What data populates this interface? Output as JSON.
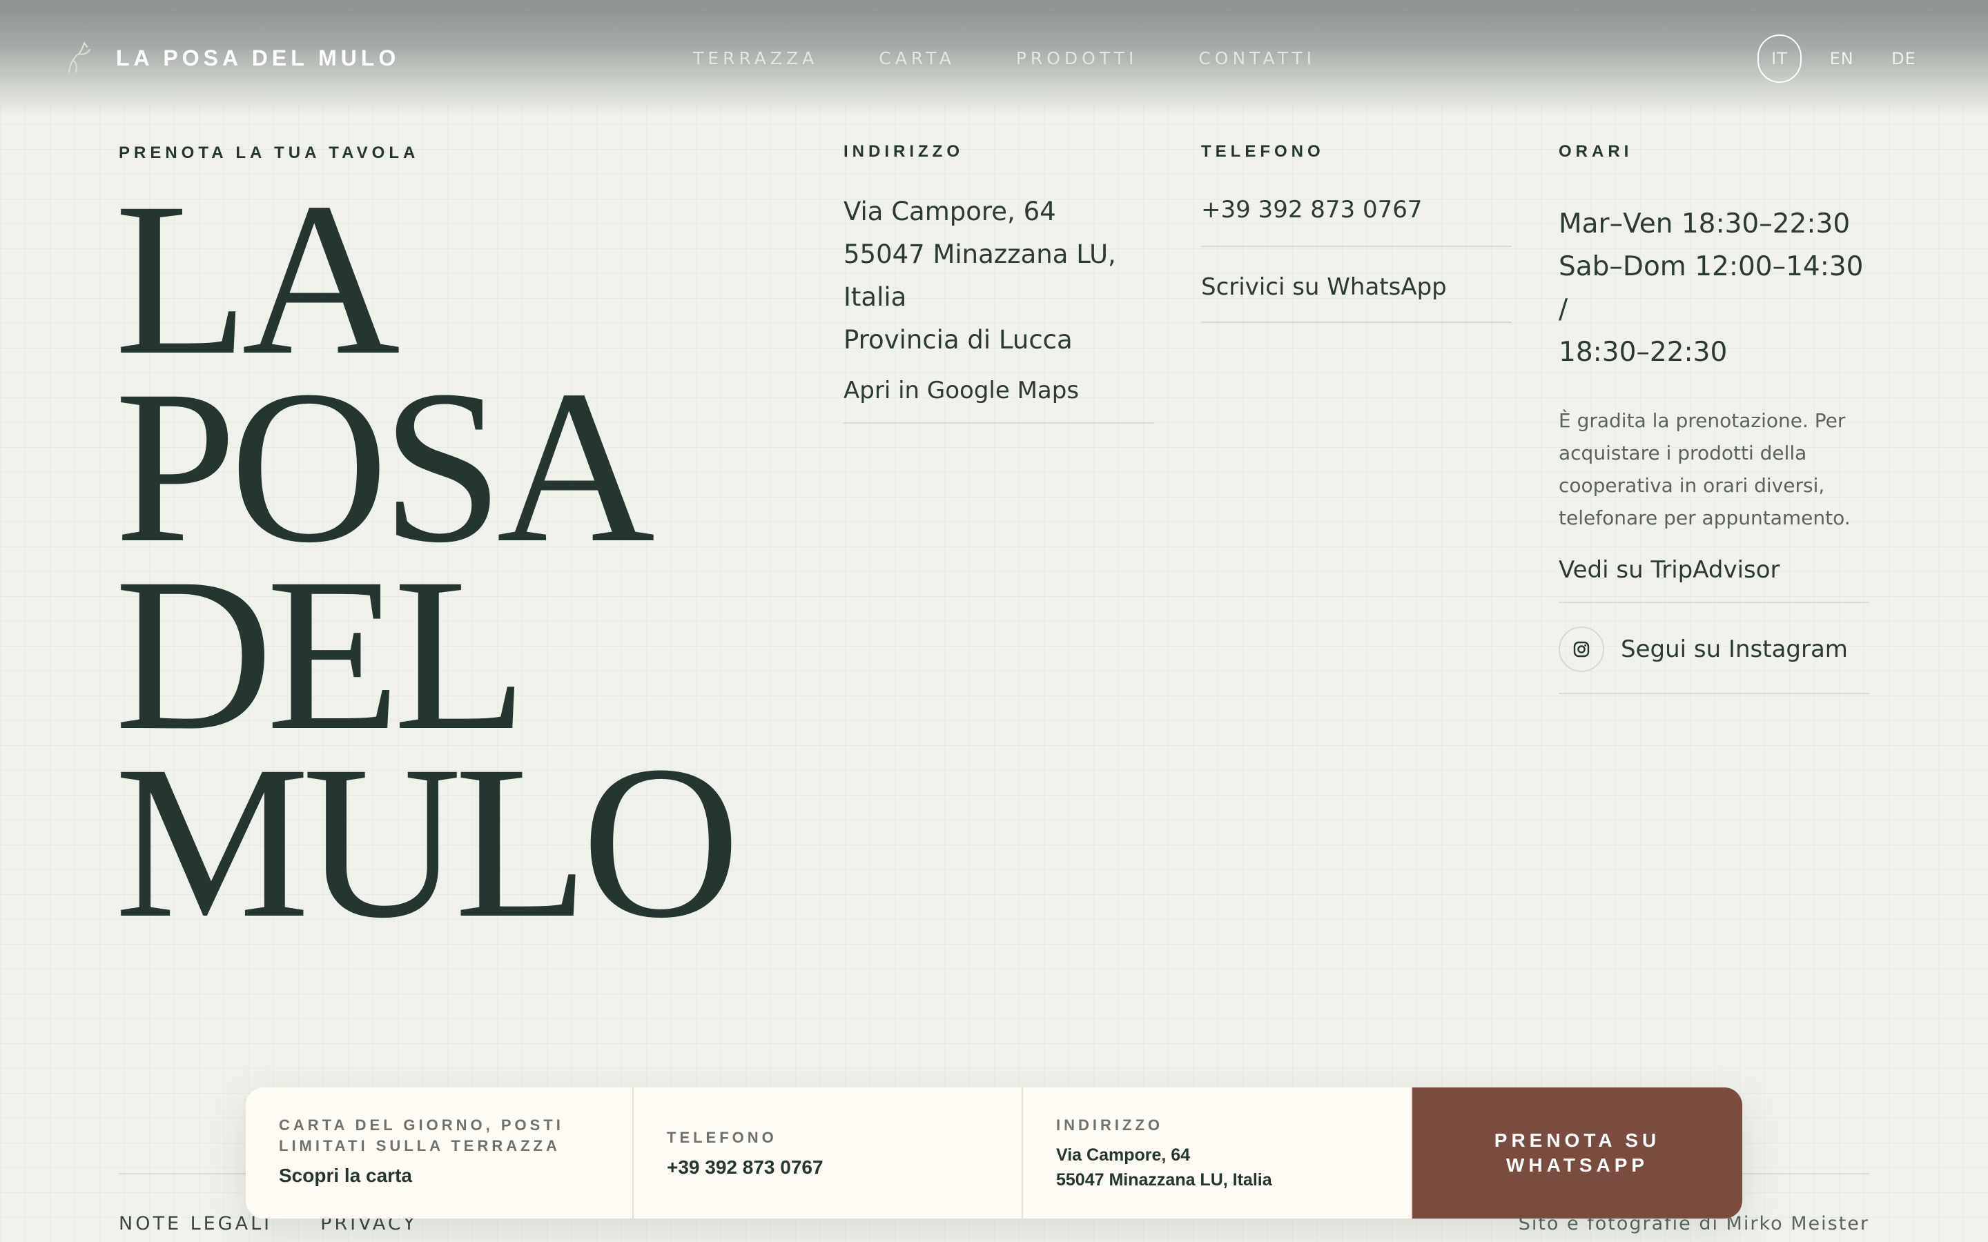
{
  "header": {
    "brand": "LA POSA DEL MULO",
    "nav": [
      {
        "label": "TERRAZZA"
      },
      {
        "label": "CARTA"
      },
      {
        "label": "PRODOTTI"
      },
      {
        "label": "CONTATTI"
      }
    ],
    "languages": [
      {
        "code": "IT",
        "active": true
      },
      {
        "code": "EN",
        "active": false
      },
      {
        "code": "DE",
        "active": false
      }
    ]
  },
  "hero": {
    "eyebrow": "PRENOTA LA TUA TAVOLA",
    "title_lines": [
      "LA",
      "POSA",
      "DEL",
      "MULO"
    ]
  },
  "address": {
    "label": "INDIRIZZO",
    "lines": [
      "Via Campore, 64",
      "55047 Minazzana LU,",
      "Italia",
      "Provincia di Lucca"
    ],
    "maps_link": "Apri in Google Maps"
  },
  "phone": {
    "label": "TELEFONO",
    "number": "+39 392 873 0767",
    "whatsapp_link": "Scrivici su WhatsApp"
  },
  "hours": {
    "label": "ORARI",
    "lines": [
      "Mar–Ven 18:30–22:30",
      "Sab–Dom 12:00–14:30 /",
      "18:30–22:30"
    ],
    "note": "È gradita la prenotazione. Per acquistare i prodotti della cooperativa in orari diversi, telefonare per appuntamento.",
    "tripadvisor_link": "Vedi su TripAdvisor",
    "instagram_link": "Segui su Instagram"
  },
  "booking_bar": {
    "menu_label": "CARTA DEL GIORNO, POSTI LIMITATI SULLA TERRAZZA",
    "menu_link": "Scopri la carta",
    "phone_label": "TELEFONO",
    "phone_value": "+39 392 873 0767",
    "address_label": "INDIRIZZO",
    "address_line1": "Via Campore, 64",
    "address_line2": "55047 Minazzana LU, Italia",
    "cta": "PRENOTA SU WHATSAPP"
  },
  "footer": {
    "legal": "NOTE LEGALI",
    "privacy": "PRIVACY",
    "credit": "Sito e fotografie di Mirko Meister"
  },
  "colors": {
    "background": "#eff1ea",
    "ink": "#253530",
    "cta": "#7a4c3f",
    "card": "#fdfbf4"
  },
  "icons": {
    "logo": "mule-logo-icon",
    "instagram": "instagram-icon"
  }
}
